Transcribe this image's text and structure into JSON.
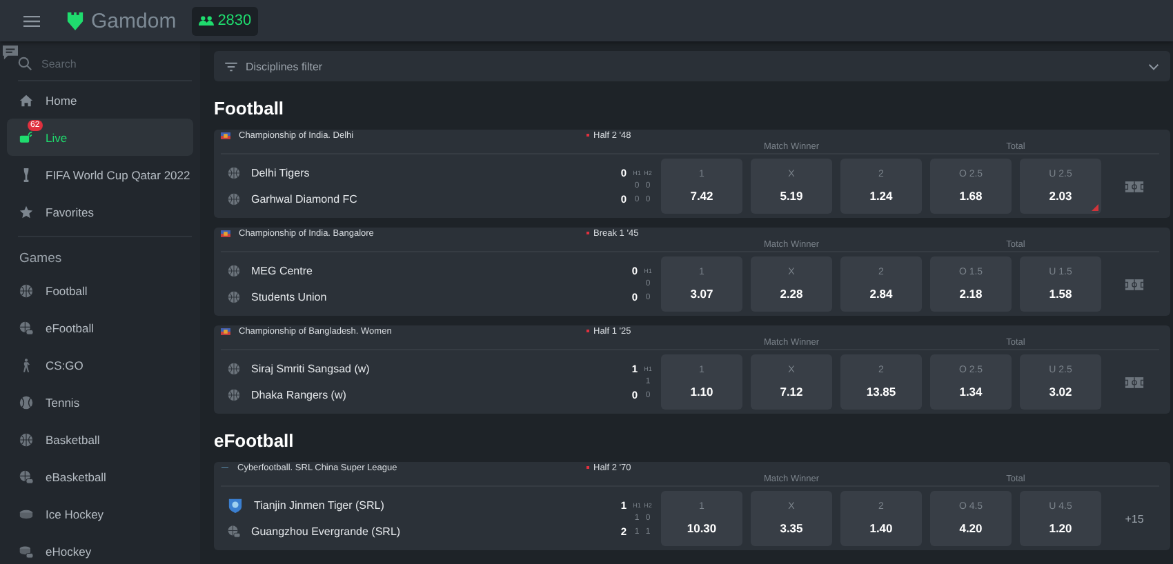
{
  "header": {
    "logo": "Gamdom",
    "online": "2830"
  },
  "sidebar": {
    "search": {
      "placeholder": "Search"
    },
    "nav": [
      {
        "label": "Home",
        "selected": false
      },
      {
        "label": "Live",
        "selected": true,
        "badge": "62"
      },
      {
        "label": "FIFA World Cup Qatar 2022",
        "selected": false
      },
      {
        "label": "Favorites",
        "selected": false
      }
    ],
    "games_title": "Games",
    "games": [
      {
        "label": "Football"
      },
      {
        "label": "eFootball"
      },
      {
        "label": "CS:GO"
      },
      {
        "label": "Tennis"
      },
      {
        "label": "Basketball"
      },
      {
        "label": "eBasketball"
      },
      {
        "label": "Ice Hockey"
      },
      {
        "label": "eHockey"
      }
    ]
  },
  "filter": {
    "label": "Disciplines filter"
  },
  "sections": [
    {
      "title": "Football",
      "matches": [
        {
          "league": "Championship of India. Delhi",
          "kind": "flag",
          "status": "Half 2 '48",
          "market_1": "Match Winner",
          "market_2": "Total",
          "periods": [
            "H1",
            "H2"
          ],
          "teams": [
            {
              "name": "Delhi Tigers",
              "kind": "club",
              "score": "0",
              "periods": [
                "0",
                "0"
              ]
            },
            {
              "name": "Garhwal Diamond FC",
              "kind": "club",
              "score": "0",
              "periods": [
                "0",
                "0"
              ]
            }
          ],
          "odds": [
            {
              "label": "1",
              "value": "7.42",
              "dropped": false
            },
            {
              "label": "X",
              "value": "5.19",
              "dropped": false
            },
            {
              "label": "2",
              "value": "1.24",
              "dropped": false
            },
            {
              "label": "O 2.5",
              "value": "1.68",
              "dropped": false
            },
            {
              "label": "U 2.5",
              "value": "2.03",
              "dropped": true
            }
          ],
          "extra": {
            "kind": "stats"
          }
        },
        {
          "league": "Championship of India. Bangalore",
          "kind": "flag",
          "status": "Break 1 '45",
          "market_1": "Match Winner",
          "market_2": "Total",
          "periods": [
            "H1"
          ],
          "teams": [
            {
              "name": "MEG Centre",
              "kind": "club",
              "score": "0",
              "periods": [
                "0"
              ]
            },
            {
              "name": "Students Union",
              "kind": "club",
              "score": "0",
              "periods": [
                "0"
              ]
            }
          ],
          "odds": [
            {
              "label": "1",
              "value": "3.07",
              "dropped": false
            },
            {
              "label": "X",
              "value": "2.28",
              "dropped": false
            },
            {
              "label": "2",
              "value": "2.84",
              "dropped": false
            },
            {
              "label": "O 1.5",
              "value": "2.18",
              "dropped": false
            },
            {
              "label": "U 1.5",
              "value": "1.58",
              "dropped": false
            }
          ],
          "extra": {
            "kind": "stats"
          }
        },
        {
          "league": "Championship of Bangladesh. Women",
          "kind": "flag",
          "status": "Half 1 '25",
          "market_1": "Match Winner",
          "market_2": "Total",
          "periods": [
            "H1"
          ],
          "teams": [
            {
              "name": "Siraj Smriti Sangsad (w)",
              "kind": "club",
              "score": "1",
              "periods": [
                "1"
              ]
            },
            {
              "name": "Dhaka Rangers (w)",
              "kind": "club",
              "score": "0",
              "periods": [
                "0"
              ]
            }
          ],
          "odds": [
            {
              "label": "1",
              "value": "1.10",
              "dropped": false
            },
            {
              "label": "X",
              "value": "7.12",
              "dropped": false
            },
            {
              "label": "2",
              "value": "13.85",
              "dropped": false
            },
            {
              "label": "O 2.5",
              "value": "1.34",
              "dropped": false
            },
            {
              "label": "U 2.5",
              "value": "3.02",
              "dropped": false
            }
          ],
          "extra": {
            "kind": "stats"
          }
        }
      ]
    },
    {
      "title": "eFootball",
      "matches": [
        {
          "league": "Cyberfootball. SRL China Super League",
          "kind": "esport",
          "status": "Half 2 '70",
          "market_1": "Match Winner",
          "market_2": "Total",
          "periods": [
            "H1",
            "H2"
          ],
          "teams": [
            {
              "name": "Tianjin Jinmen Tiger (SRL)",
              "kind": "crest",
              "score": "1",
              "periods": [
                "1",
                "0"
              ]
            },
            {
              "name": "Guangzhou Evergrande (SRL)",
              "kind": "esport",
              "score": "2",
              "periods": [
                "1",
                "1"
              ]
            }
          ],
          "odds": [
            {
              "label": "1",
              "value": "10.30",
              "dropped": false
            },
            {
              "label": "X",
              "value": "3.35",
              "dropped": false
            },
            {
              "label": "2",
              "value": "1.40",
              "dropped": false
            },
            {
              "label": "O 4.5",
              "value": "4.20",
              "dropped": false
            },
            {
              "label": "U 4.5",
              "value": "1.20",
              "dropped": false
            }
          ],
          "extra": {
            "kind": "count",
            "text": "+15"
          }
        }
      ]
    }
  ]
}
